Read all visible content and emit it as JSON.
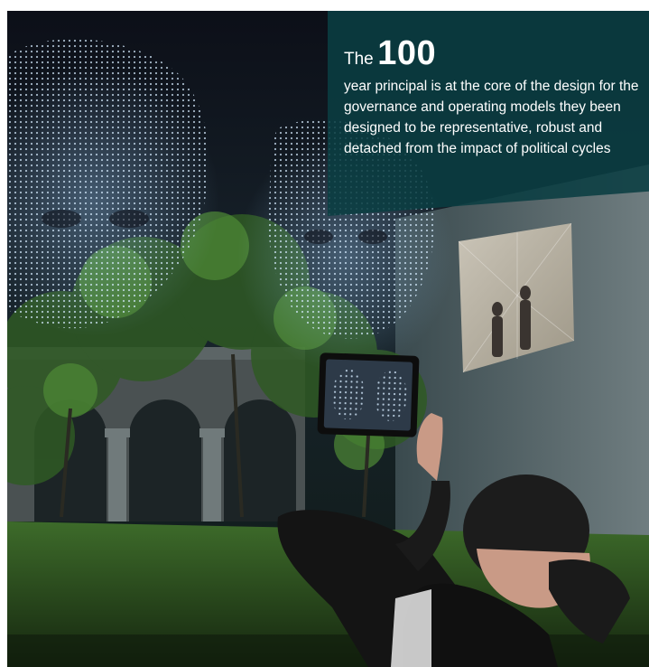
{
  "overlay": {
    "lead_word": "The",
    "highlight_number": "100",
    "body": "year principal is at the core of the design for the governance and operating models they been designed to be representative, robust and detached from the impact of political cycles"
  },
  "colors": {
    "overlay_bg": "#0a3e42",
    "text": "#ffffff",
    "hologram": "#c8e4ff",
    "grass": "#2c5a22"
  },
  "scene": {
    "elements": [
      "night-sky",
      "hologram-head-left",
      "hologram-head-right",
      "cloister-arches",
      "tree-foliage",
      "projected-silhouette-panel",
      "held-tablet",
      "reclining-man",
      "lawn"
    ]
  }
}
